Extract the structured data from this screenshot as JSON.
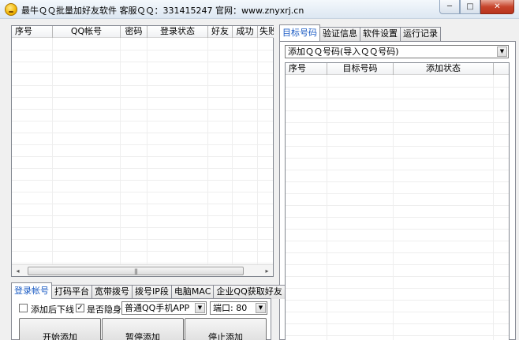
{
  "window": {
    "title": "最牛ＱＱ批量加好友软件    客服ＱＱ：331415247   官网：www.znyxrj.cn",
    "min_glyph": "─",
    "max_glyph": "□",
    "close_glyph": "✕"
  },
  "left_grid": {
    "columns": [
      "序号",
      "QQ帐号",
      "密码",
      "登录状态",
      "好友",
      "成功",
      "失败"
    ],
    "scroll_left": "◂",
    "scroll_right": "▸",
    "thumb_grip": "|||"
  },
  "right_tabs": [
    "目标号码",
    "验证信息",
    "软件设置",
    "运行记录"
  ],
  "right_panel": {
    "mode_combo": "添加ＱＱ号码(导入ＱＱ号码)",
    "columns": [
      "序号",
      "目标号码",
      "添加状态"
    ]
  },
  "bottom_tabs": [
    "登录帐号",
    "打码平台",
    "宽带拨号",
    "拨号IP段",
    "电脑MAC",
    "企业QQ获取好友"
  ],
  "options": {
    "logout_after_add_label": "添加后下线",
    "logout_after_add_checked": false,
    "invisible_label": "是否隐身",
    "invisible_checked": true,
    "client_combo": "普通QQ手机APP",
    "port_combo": "端口: 80",
    "check_mark": "✓",
    "drop_arrow": "▼"
  },
  "actions": {
    "start": "开始添加",
    "pause": "暂停添加",
    "stop": "停止添加"
  }
}
